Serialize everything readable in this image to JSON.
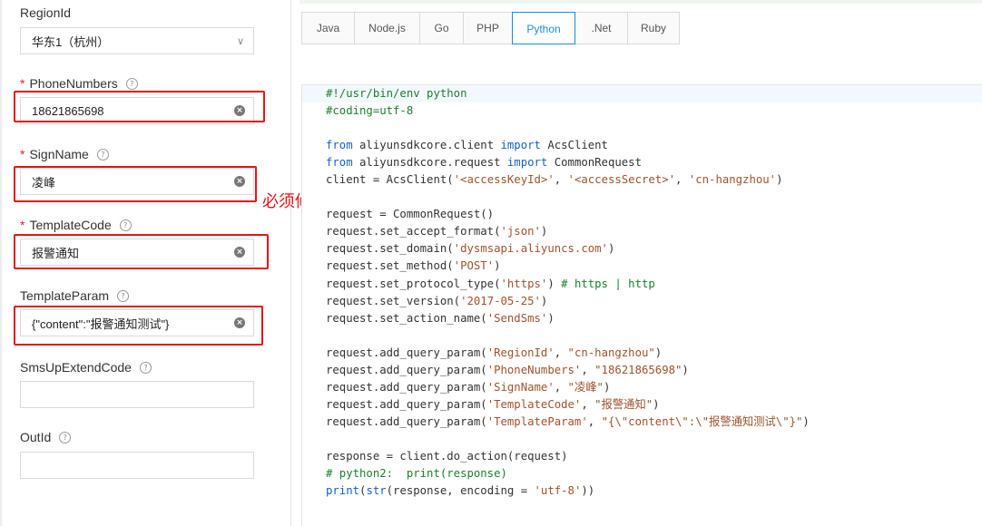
{
  "form": {
    "region": {
      "label": "RegionId",
      "value": "华东1（杭州）"
    },
    "phone": {
      "label": "PhoneNumbers",
      "value": "18621865698",
      "required": true
    },
    "sign": {
      "label": "SignName",
      "value": "凌峰",
      "required": true
    },
    "template_code": {
      "label": "TemplateCode",
      "value": "报警通知",
      "required": true
    },
    "template_param": {
      "label": "TemplateParam",
      "value": "{\"content\":\"报警通知测试\"}"
    },
    "sms_up": {
      "label": "SmsUpExtendCode",
      "value": ""
    },
    "out_id": {
      "label": "OutId",
      "value": ""
    },
    "required_mark": "*",
    "help_glyph": "?",
    "clear_glyph": "×",
    "chevron_glyph": "∨"
  },
  "tabs": [
    {
      "label": "Java",
      "active": false
    },
    {
      "label": "Node.js",
      "active": false
    },
    {
      "label": "Go",
      "active": false
    },
    {
      "label": "PHP",
      "active": false
    },
    {
      "label": "Python",
      "active": true
    },
    {
      "label": ".Net",
      "active": false
    },
    {
      "label": "Ruby",
      "active": false
    }
  ],
  "annotation": "必须修改为你的签名",
  "code_lines": [
    [
      [
        "cm",
        "#!/usr/bin/env python"
      ]
    ],
    [
      [
        "cm",
        "#coding=utf-8"
      ]
    ],
    [],
    [
      [
        "kw",
        "from"
      ],
      [
        "",
        " aliyunsdkcore.client "
      ],
      [
        "kw",
        "import"
      ],
      [
        "",
        " AcsClient"
      ]
    ],
    [
      [
        "kw",
        "from"
      ],
      [
        "",
        " aliyunsdkcore.request "
      ],
      [
        "kw",
        "import"
      ],
      [
        "",
        " CommonRequest"
      ]
    ],
    [
      [
        "",
        "client = AcsClient("
      ],
      [
        "str",
        "'<accessKeyId>'"
      ],
      [
        "",
        ", "
      ],
      [
        "str",
        "'<accessSecret>'"
      ],
      [
        "",
        ", "
      ],
      [
        "str",
        "'cn-hangzhou'"
      ],
      [
        "",
        ")"
      ]
    ],
    [],
    [
      [
        "",
        "request = CommonRequest()"
      ]
    ],
    [
      [
        "",
        "request.set_accept_format("
      ],
      [
        "str",
        "'json'"
      ],
      [
        "",
        ")"
      ]
    ],
    [
      [
        "",
        "request.set_domain("
      ],
      [
        "str",
        "'dysmsapi.aliyuncs.com'"
      ],
      [
        "",
        ")"
      ]
    ],
    [
      [
        "",
        "request.set_method("
      ],
      [
        "str",
        "'POST'"
      ],
      [
        "",
        ")"
      ]
    ],
    [
      [
        "",
        "request.set_protocol_type("
      ],
      [
        "str",
        "'https'"
      ],
      [
        "",
        ") "
      ],
      [
        "cm",
        "# https | http"
      ]
    ],
    [
      [
        "",
        "request.set_version("
      ],
      [
        "str",
        "'2017-05-25'"
      ],
      [
        "",
        ")"
      ]
    ],
    [
      [
        "",
        "request.set_action_name("
      ],
      [
        "str",
        "'SendSms'"
      ],
      [
        "",
        ")"
      ]
    ],
    [],
    [
      [
        "",
        "request.add_query_param("
      ],
      [
        "str",
        "'RegionId'"
      ],
      [
        "",
        ", "
      ],
      [
        "str",
        "\"cn-hangzhou\""
      ],
      [
        "",
        ")"
      ]
    ],
    [
      [
        "",
        "request.add_query_param("
      ],
      [
        "str",
        "'PhoneNumbers'"
      ],
      [
        "",
        ", "
      ],
      [
        "str",
        "\"18621865698\""
      ],
      [
        "",
        ")"
      ]
    ],
    [
      [
        "",
        "request.add_query_param("
      ],
      [
        "str",
        "'SignName'"
      ],
      [
        "",
        ", "
      ],
      [
        "str",
        "\"凌峰\""
      ],
      [
        "",
        ")"
      ]
    ],
    [
      [
        "",
        "request.add_query_param("
      ],
      [
        "str",
        "'TemplateCode'"
      ],
      [
        "",
        ", "
      ],
      [
        "str",
        "\"报警通知\""
      ],
      [
        "",
        ")"
      ]
    ],
    [
      [
        "",
        "request.add_query_param("
      ],
      [
        "str",
        "'TemplateParam'"
      ],
      [
        "",
        ", "
      ],
      [
        "str",
        "\"{\\\"content\\\":\\\"报警通知测试\\\"}\""
      ],
      [
        "",
        ")"
      ]
    ],
    [],
    [
      [
        "",
        "response = client.do_action(request)"
      ]
    ],
    [
      [
        "cm",
        "# python2:  print(response)"
      ]
    ],
    [
      [
        "kw",
        "print"
      ],
      [
        "",
        "("
      ],
      [
        "kw",
        "str"
      ],
      [
        "",
        "(response, encoding = "
      ],
      [
        "str",
        "'utf-8'"
      ],
      [
        "",
        "))"
      ]
    ]
  ]
}
